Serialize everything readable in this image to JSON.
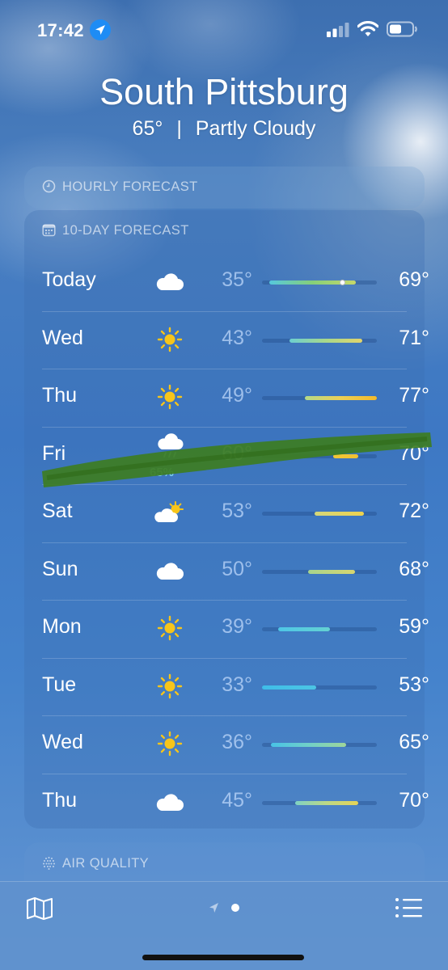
{
  "status_bar": {
    "time": "17:42"
  },
  "header": {
    "city": "South Pittsburg",
    "temp": "65°",
    "separator": "|",
    "condition": "Partly Cloudy"
  },
  "hourly_card": {
    "title": "HOURLY FORECAST"
  },
  "daily_card": {
    "title": "10-DAY FORECAST",
    "days": [
      {
        "day": "Today",
        "icon": "cloud-icon",
        "precip": "",
        "low": "35°",
        "high": "69°",
        "bar_start": 0.06,
        "bar_end": 0.82,
        "current": 0.7,
        "colors": [
          "#56c8dd",
          "#86cf78",
          "#c6d86a"
        ]
      },
      {
        "day": "Wed",
        "icon": "sun-icon",
        "precip": "",
        "low": "43°",
        "high": "71°",
        "bar_start": 0.24,
        "bar_end": 0.87,
        "colors": [
          "#6ccfd0",
          "#a8d88a",
          "#e2d46c"
        ]
      },
      {
        "day": "Thu",
        "icon": "sun-icon",
        "precip": "",
        "low": "49°",
        "high": "77°",
        "bar_start": 0.37,
        "bar_end": 1.0,
        "colors": [
          "#b3d98a",
          "#eccf55",
          "#f4ba2a"
        ]
      },
      {
        "day": "Fri",
        "icon": "cloud-rain-icon",
        "precip": "65%",
        "low": "60°",
        "high": "70°",
        "bar_start": 0.62,
        "bar_end": 0.84,
        "colors": [
          "#f0c838",
          "#f0c030"
        ]
      },
      {
        "day": "Sat",
        "icon": "partly-cloudy-icon",
        "precip": "",
        "low": "53°",
        "high": "72°",
        "bar_start": 0.46,
        "bar_end": 0.89,
        "colors": [
          "#d4d77a",
          "#eed24e"
        ]
      },
      {
        "day": "Sun",
        "icon": "cloud-icon",
        "precip": "",
        "low": "50°",
        "high": "68°",
        "bar_start": 0.4,
        "bar_end": 0.81,
        "colors": [
          "#a6d48e",
          "#d8d670"
        ]
      },
      {
        "day": "Mon",
        "icon": "sun-icon",
        "precip": "",
        "low": "39°",
        "high": "59°",
        "bar_start": 0.14,
        "bar_end": 0.59,
        "colors": [
          "#4ec6e6",
          "#64d2d2"
        ]
      },
      {
        "day": "Tue",
        "icon": "sun-icon",
        "precip": "",
        "low": "33°",
        "high": "53°",
        "bar_start": 0.0,
        "bar_end": 0.47,
        "colors": [
          "#3fbde8",
          "#4cc5e4"
        ]
      },
      {
        "day": "Wed",
        "icon": "sun-icon",
        "precip": "",
        "low": "36°",
        "high": "65°",
        "bar_start": 0.08,
        "bar_end": 0.73,
        "colors": [
          "#48c2e6",
          "#70d0c8",
          "#9fd69a"
        ]
      },
      {
        "day": "Thu",
        "icon": "cloud-icon",
        "precip": "",
        "low": "45°",
        "high": "70°",
        "bar_start": 0.29,
        "bar_end": 0.84,
        "colors": [
          "#7fd2c4",
          "#bcd886",
          "#e6d356"
        ]
      }
    ]
  },
  "air_card": {
    "title": "AIR QUALITY"
  },
  "colors": {
    "sun": "#f7c51a",
    "location_badge": "#1e8cf5",
    "scribble": "#3d7d22"
  }
}
